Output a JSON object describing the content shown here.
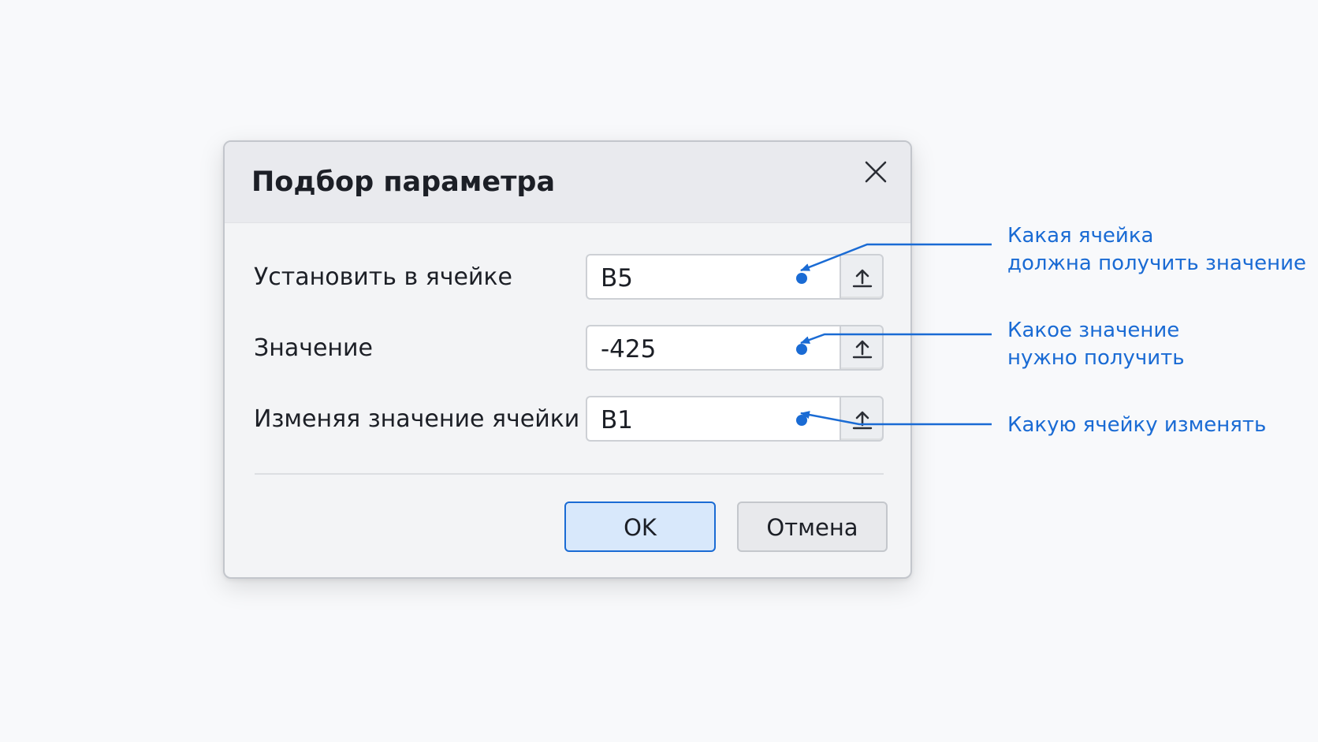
{
  "dialog": {
    "title": "Подбор параметра",
    "close_icon": "close-icon",
    "fields": [
      {
        "label": "Установить в ячейке",
        "value": "B5",
        "picker_icon": "upload-arrow-icon"
      },
      {
        "label": "Значение",
        "value": "-425",
        "picker_icon": "upload-arrow-icon"
      },
      {
        "label": "Изменяя значение ячейки",
        "value": "B1",
        "picker_icon": "upload-arrow-icon"
      }
    ],
    "buttons": {
      "ok": "OK",
      "cancel": "Отмена"
    }
  },
  "annotations": [
    {
      "lines": [
        "Какая ячейка",
        "должна получить значение"
      ]
    },
    {
      "lines": [
        "Какое значение",
        "нужно получить"
      ]
    },
    {
      "lines": [
        "Какую ячейку изменять"
      ]
    }
  ],
  "colors": {
    "accent": "#1a6bd4",
    "dialog_background": "#f3f4f6",
    "titlebar_background": "#e9eaee",
    "ok_button_background": "#d8e8fb",
    "page_background": "#f8f9fb"
  }
}
